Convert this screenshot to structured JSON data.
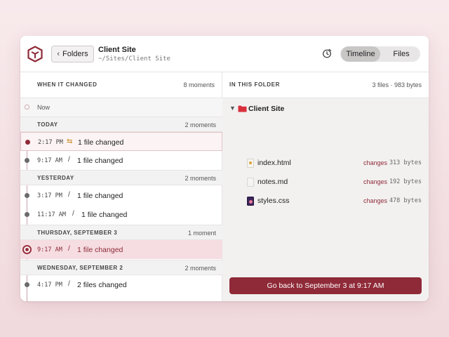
{
  "header": {
    "back_label": "Folders",
    "title": "Client Site",
    "path": "~/Sites/Client Site",
    "view_tabs": [
      "Timeline",
      "Files"
    ],
    "active_tab": "Timeline"
  },
  "timeline": {
    "column_label": "WHEN IT CHANGED",
    "count": "8 moments",
    "now_label": "Now",
    "sections": [
      {
        "label": "TODAY",
        "count": "2 moments",
        "entries": [
          {
            "time": "2:17 PM",
            "glyph": "⇆",
            "text": "1 file changed"
          },
          {
            "time": "9:17 AM",
            "glyph": "/",
            "text": "1 file changed"
          }
        ]
      },
      {
        "label": "YESTERDAY",
        "count": "2 moments",
        "entries": [
          {
            "time": "3:17 PM",
            "glyph": "/",
            "text": "1 file changed"
          },
          {
            "time": "11:17 AM",
            "glyph": "/",
            "text": "1 file changed"
          }
        ]
      },
      {
        "label": "THURSDAY, SEPTEMBER 3",
        "count": "1 moment",
        "entries": [
          {
            "time": "9:17 AM",
            "glyph": "/",
            "text": "1 file changed",
            "selected": true
          }
        ]
      },
      {
        "label": "WEDNESDAY, SEPTEMBER 2",
        "count": "2 moments",
        "entries": [
          {
            "time": "4:17 PM",
            "glyph": "/",
            "text": "2 files changed"
          }
        ]
      }
    ]
  },
  "folder": {
    "column_label": "IN THIS FOLDER",
    "summary": "3 files · 983 bytes",
    "name": "Client Site",
    "files": [
      {
        "name": "index.html",
        "change": "changes",
        "size": "313 bytes",
        "icon": "html-file-icon"
      },
      {
        "name": "notes.md",
        "change": "changes",
        "size": "192 bytes",
        "icon": "markdown-file-icon"
      },
      {
        "name": "styles.css",
        "change": "changes",
        "size": "478 bytes",
        "icon": "css-file-icon"
      }
    ],
    "restore_label": "Go back to September 3 at 9:17 AM"
  },
  "colors": {
    "accent": "#8f2a38",
    "selected_row": "#f5dde1",
    "timeline_line": "#c9a4aa"
  }
}
